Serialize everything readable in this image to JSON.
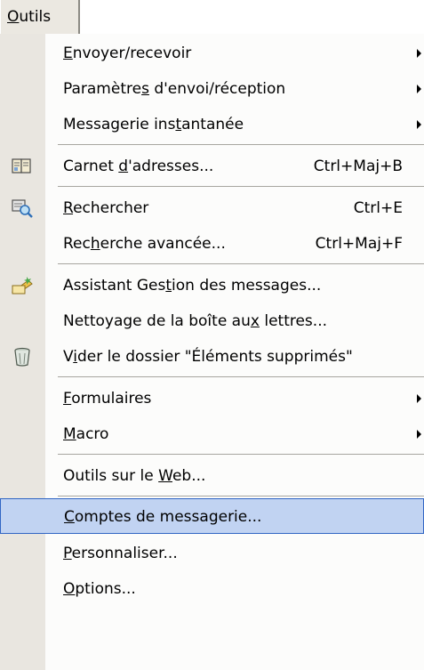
{
  "menubar": {
    "title_ul": "O",
    "title_rest": "utils"
  },
  "menu": {
    "items": [
      {
        "ul_pre": "",
        "ul": "E",
        "ul_post": "nvoyer/recevoir",
        "shortcut": "",
        "submenu": true,
        "icon": ""
      },
      {
        "ul_pre": "Paramètre",
        "ul": "s",
        "ul_post": " d'envoi/réception",
        "shortcut": "",
        "submenu": true,
        "icon": ""
      },
      {
        "ul_pre": "Messagerie ins",
        "ul": "t",
        "ul_post": "antanée",
        "shortcut": "",
        "submenu": true,
        "icon": ""
      },
      {
        "ul_pre": "Carnet ",
        "ul": "d",
        "ul_post": "'adresses...",
        "shortcut": "Ctrl+Maj+B",
        "submenu": false,
        "icon": "address-book-icon"
      },
      {
        "ul_pre": "",
        "ul": "R",
        "ul_post": "echercher",
        "shortcut": "Ctrl+E",
        "submenu": false,
        "icon": "find-icon"
      },
      {
        "ul_pre": "Rec",
        "ul": "h",
        "ul_post": "erche avancée...",
        "shortcut": "Ctrl+Maj+F",
        "submenu": false,
        "icon": ""
      },
      {
        "ul_pre": "Assistant Ges",
        "ul": "t",
        "ul_post": "ion des messages...",
        "shortcut": "",
        "submenu": false,
        "icon": "rules-wizard-icon"
      },
      {
        "ul_pre": "Nettoyage de la boîte au",
        "ul": "x",
        "ul_post": " lettres...",
        "shortcut": "",
        "submenu": false,
        "icon": ""
      },
      {
        "ul_pre": "V",
        "ul": "i",
        "ul_post": "der le dossier \"Éléments supprimés\"",
        "shortcut": "",
        "submenu": false,
        "icon": "trash-icon"
      },
      {
        "ul_pre": "",
        "ul": "F",
        "ul_post": "ormulaires",
        "shortcut": "",
        "submenu": true,
        "icon": ""
      },
      {
        "ul_pre": "",
        "ul": "M",
        "ul_post": "acro",
        "shortcut": "",
        "submenu": true,
        "icon": ""
      },
      {
        "ul_pre": "Outils sur le ",
        "ul": "W",
        "ul_post": "eb...",
        "shortcut": "",
        "submenu": false,
        "icon": ""
      },
      {
        "ul_pre": "",
        "ul": "C",
        "ul_post": "omptes de messagerie...",
        "shortcut": "",
        "submenu": false,
        "icon": "",
        "selected": true
      },
      {
        "ul_pre": "",
        "ul": "P",
        "ul_post": "ersonnaliser...",
        "shortcut": "",
        "submenu": false,
        "icon": ""
      },
      {
        "ul_pre": "",
        "ul": "O",
        "ul_post": "ptions...",
        "shortcut": "",
        "submenu": false,
        "icon": ""
      }
    ]
  }
}
